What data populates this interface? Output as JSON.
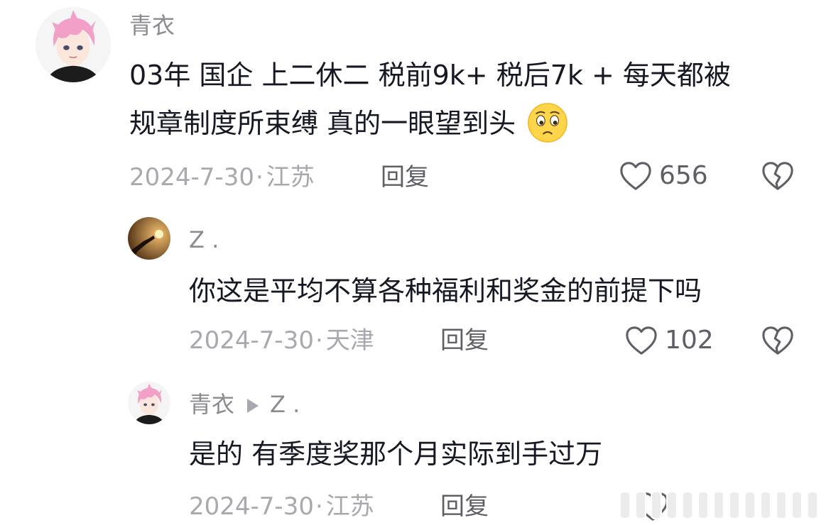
{
  "comments": [
    {
      "user": "青衣",
      "lines": [
        "03年 国企 上二休二 税前9k+ 税后7k + 每天都被",
        "规章制度所束缚 真的一眼望到头"
      ],
      "emoji": "pensive-face-emoji",
      "date": "2024-7-30",
      "dot": "·",
      "location": "江苏",
      "reply_label": "回复",
      "likes": "656"
    },
    {
      "user": "Z .",
      "text": "你这是平均不算各种福利和奖金的前提下吗",
      "date": "2024-7-30",
      "dot": "·",
      "location": "天津",
      "reply_label": "回复",
      "likes": "102"
    },
    {
      "user": "青衣",
      "reply_to": "Z .",
      "text": "是的 有季度奖那个月实际到手过万",
      "date": "2024-7-30",
      "dot": "·",
      "location": "江苏",
      "reply_label": "回复"
    }
  ],
  "icons": {
    "like": "heart-outline-icon",
    "dislike": "broken-heart-icon",
    "reply_arrow": "triangle-right-icon"
  },
  "colors": {
    "text": "#161823",
    "secondary": "#a8a9ae",
    "username": "#8a8b91",
    "hair": "#f3a0c8"
  }
}
